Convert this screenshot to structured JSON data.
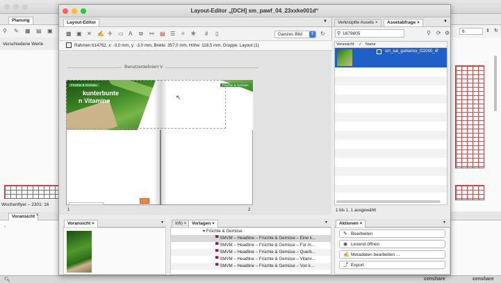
{
  "main_window": {
    "title": "Layout-Editor „[DCH] sm_pawf_04_23xxke001d“"
  },
  "planung": {
    "tab": "Planung",
    "label": "Verschiedene Werte",
    "footer": "Wochenflyer – 2301: 16"
  },
  "voransicht_left": {
    "tab": "Voransicht"
  },
  "layout_editor": {
    "tab": "Layout-Editor",
    "zoom_select": "Ganzes Bild",
    "frame_info": "Rahmen b14762,  x: -3,0 mm, y: -3,0 mm, Breite: 357,0 mm, Höhe: 118,5 mm,  Gruppe: Layout (1)",
    "spread_label": "Benutzerdefiniert V",
    "page_left_number": "1",
    "page_right_number": "2",
    "headline_line1": "kunterbunte",
    "headline_line2": "n Vitamine",
    "green_tag_left": "Früchte & Gemüse",
    "green_tag_right": "Früchte & Gemüse"
  },
  "assets_panel": {
    "tab1": "Verknüpfte Assets",
    "tab2": "Assetabfrage",
    "search_value": "1879805",
    "col_preview": "Voransicht",
    "col_name": "Name",
    "row_name": "sm_sai_gurkenxx_f22000_4f",
    "status": "1 bis 1, 1 ausgewählt"
  },
  "right_window": {
    "field_value": "6"
  },
  "voransicht_panel": {
    "tab": "Voransicht"
  },
  "info_panel": {
    "tab": "Info"
  },
  "vorlagen_panel": {
    "tab": "Vorlagen",
    "folder": "Früchte & Gemüse",
    "items": [
      "SMVM – Headline – Früchte & Gemüse – Eine k...",
      "SMVM – Headline – Früchte & Gemüse – Für m...",
      "SMVM – Headline – Früchte & Gemüse – Querb...",
      "SMVM – Headline – Früchte & Gemüse – Vitami...",
      "SMVM – Headline – Früchte & Gemüse – Von k..."
    ]
  },
  "aktionen_panel": {
    "tab": "Aktionen",
    "buttons": [
      "Bearbeiten",
      "Lesend öffnen",
      "Metadaten bearbeiten ...",
      "Export"
    ]
  },
  "bottom_bar": {
    "brand1": "censhare",
    "brand2": "censhare"
  },
  "colors": {
    "selection": "#1f5fc7",
    "veg_green": "#2e7d32",
    "tag_green": "#3a8f3a",
    "close_red": "#ff5f57",
    "min_yellow": "#febc2e",
    "max_green": "#28c840"
  }
}
